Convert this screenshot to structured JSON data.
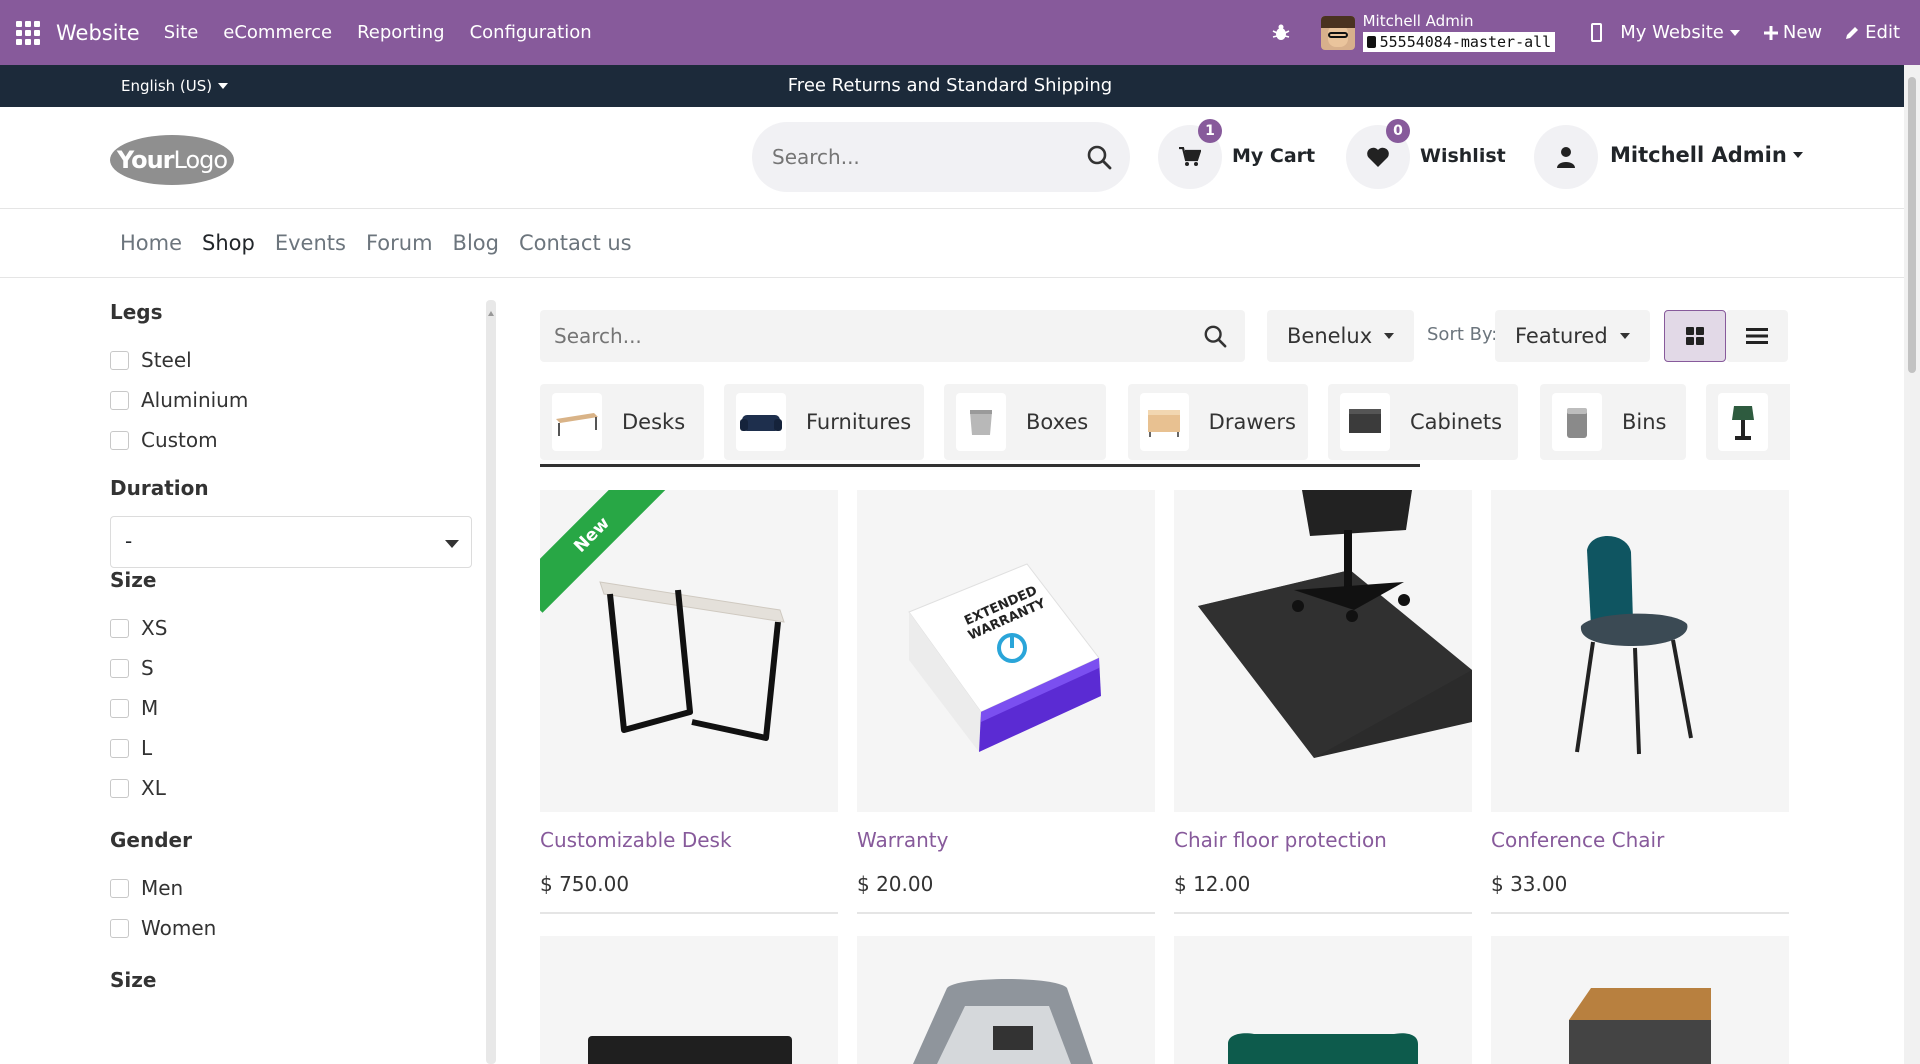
{
  "adminbar": {
    "brand": "Website",
    "menu": [
      "Site",
      "eCommerce",
      "Reporting",
      "Configuration"
    ],
    "user_name": "Mitchell Admin",
    "db_name": "55554084-master-all",
    "my_website": "My Website",
    "new_label": "New",
    "edit_label": "Edit"
  },
  "announce": {
    "language": "English (US)",
    "message": "Free Returns and Standard Shipping"
  },
  "header": {
    "logo_text_a": "Your",
    "logo_text_b": "Logo",
    "search_placeholder": "Search...",
    "cart_label": "My Cart",
    "cart_count": "1",
    "wishlist_label": "Wishlist",
    "wishlist_count": "0",
    "user_label": "Mitchell Admin"
  },
  "nav": {
    "items": [
      {
        "label": "Home",
        "active": false
      },
      {
        "label": "Shop",
        "active": true
      },
      {
        "label": "Events",
        "active": false
      },
      {
        "label": "Forum",
        "active": false
      },
      {
        "label": "Blog",
        "active": false
      },
      {
        "label": "Contact us",
        "active": false
      }
    ]
  },
  "filters": {
    "legs": {
      "title": "Legs",
      "options": [
        "Steel",
        "Aluminium",
        "Custom"
      ]
    },
    "duration": {
      "title": "Duration",
      "selected": "-"
    },
    "size": {
      "title": "Size",
      "options": [
        "XS",
        "S",
        "M",
        "L",
        "XL"
      ]
    },
    "gender": {
      "title": "Gender",
      "options": [
        "Men",
        "Women"
      ]
    },
    "size2": {
      "title": "Size"
    }
  },
  "toolbar": {
    "search_placeholder": "Search...",
    "pricelist": "Benelux",
    "sort_label": "Sort By:",
    "sort_value": "Featured"
  },
  "categories": [
    "Desks",
    "Furnitures",
    "Boxes",
    "Drawers",
    "Cabinets",
    "Bins"
  ],
  "products": [
    {
      "name": "Customizable Desk",
      "price": "$ 750.00",
      "ribbon": "New"
    },
    {
      "name": "Warranty",
      "price": "$ 20.00",
      "box_text": "EXTENDED WARRANTY"
    },
    {
      "name": "Chair floor protection",
      "price": "$ 12.00"
    },
    {
      "name": "Conference Chair",
      "price": "$ 33.00"
    }
  ],
  "colors": {
    "brand": "#875a9b",
    "announce_bg": "#1c2a3a",
    "ribbon": "#28a745"
  }
}
